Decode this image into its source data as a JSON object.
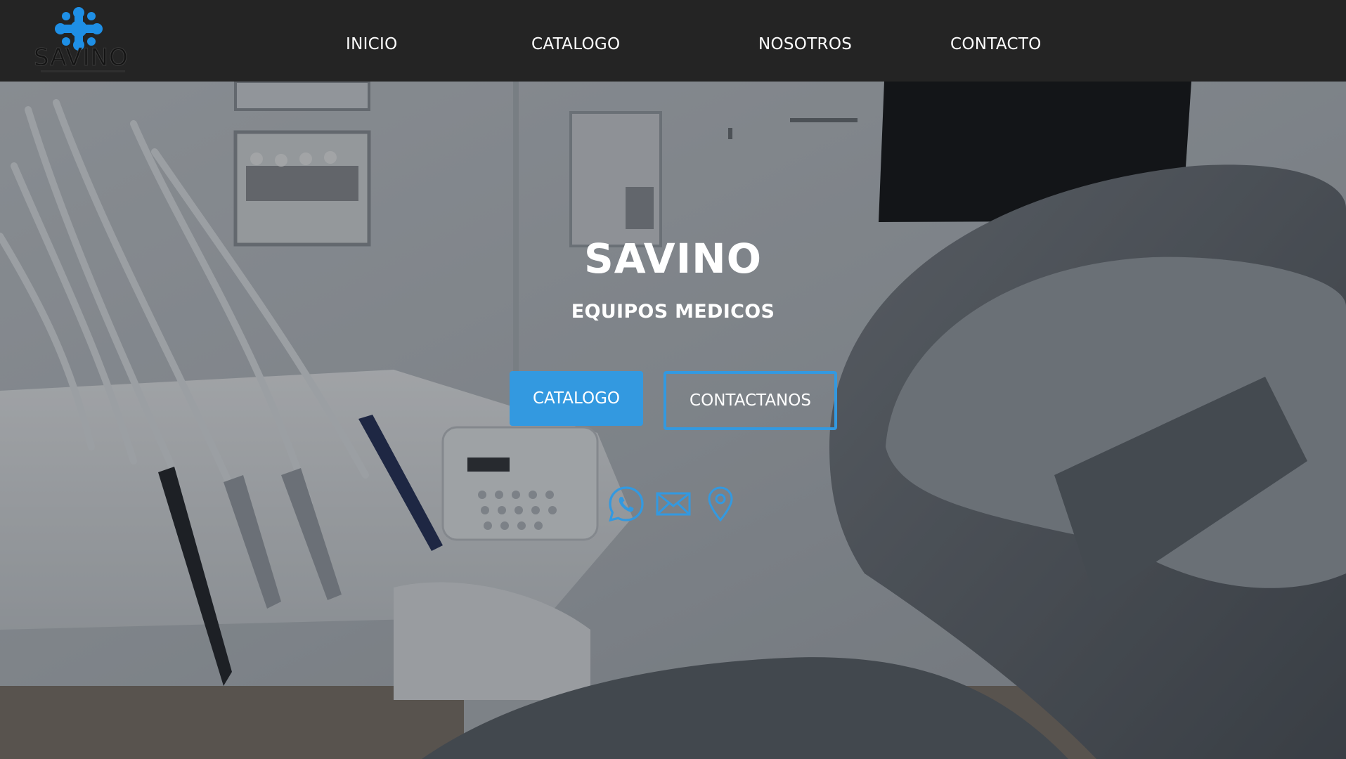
{
  "brand": {
    "name": "SAVINO",
    "accent_color": "#3399e0"
  },
  "nav": {
    "items": [
      {
        "label": "INICIO"
      },
      {
        "label": "CATALOGO"
      },
      {
        "label": "NOSOTROS"
      },
      {
        "label": "CONTACTO"
      }
    ]
  },
  "hero": {
    "title": "SAVINO",
    "subtitle": "EQUIPOS MEDICOS",
    "primary_button": "CATALOGO",
    "secondary_button": "CONTACTANOS",
    "background_image": "dental-clinic-photo",
    "social_icons": [
      "whatsapp-icon",
      "mail-icon",
      "location-pin-icon"
    ]
  }
}
